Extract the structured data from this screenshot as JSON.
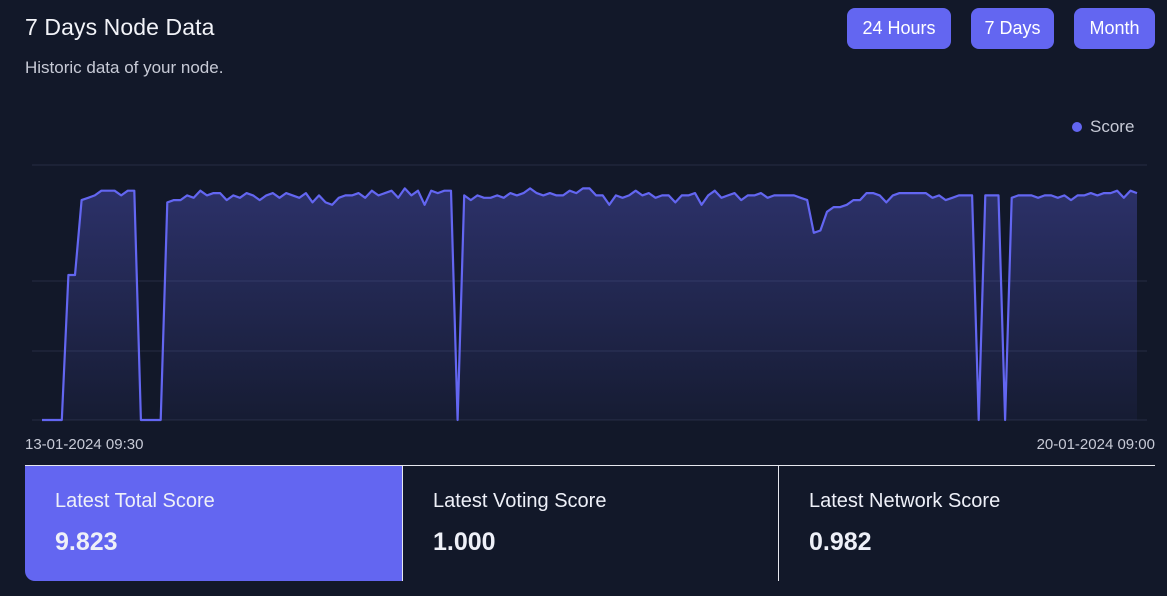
{
  "header": {
    "title": "7 Days Node Data",
    "subtitle": "Historic data of your node."
  },
  "range_buttons": [
    "24 Hours",
    "7 Days",
    "Month"
  ],
  "colors": {
    "accent": "#6366f1",
    "background": "#121829"
  },
  "chart_data": {
    "type": "area",
    "title": "",
    "xlabel": "",
    "ylabel": "",
    "legend": {
      "position": "top-right",
      "entries": [
        "Score"
      ]
    },
    "grid": true,
    "x_start_label": "13-01-2024 09:30",
    "x_end_label": "20-01-2024 09:00",
    "ylim": [
      0,
      10.9
    ],
    "series": [
      {
        "name": "Score",
        "values": [
          0,
          0,
          0,
          0,
          6.2,
          6.2,
          9.4,
          9.5,
          9.6,
          9.8,
          9.8,
          9.8,
          9.6,
          9.8,
          9.8,
          0,
          0,
          0,
          0,
          9.3,
          9.4,
          9.4,
          9.6,
          9.5,
          9.8,
          9.6,
          9.7,
          9.7,
          9.4,
          9.6,
          9.5,
          9.7,
          9.6,
          9.4,
          9.6,
          9.7,
          9.5,
          9.7,
          9.6,
          9.5,
          9.7,
          9.3,
          9.6,
          9.3,
          9.2,
          9.5,
          9.6,
          9.6,
          9.7,
          9.5,
          9.8,
          9.6,
          9.7,
          9.8,
          9.5,
          9.9,
          9.6,
          9.8,
          9.2,
          9.8,
          9.7,
          9.8,
          9.8,
          0,
          9.6,
          9.4,
          9.6,
          9.5,
          9.5,
          9.6,
          9.5,
          9.7,
          9.6,
          9.7,
          9.9,
          9.7,
          9.6,
          9.7,
          9.6,
          9.6,
          9.8,
          9.7,
          9.9,
          9.9,
          9.6,
          9.6,
          9.2,
          9.6,
          9.5,
          9.6,
          9.8,
          9.6,
          9.7,
          9.5,
          9.6,
          9.6,
          9.3,
          9.6,
          9.6,
          9.7,
          9.2,
          9.6,
          9.8,
          9.5,
          9.6,
          9.7,
          9.4,
          9.6,
          9.6,
          9.7,
          9.5,
          9.6,
          9.6,
          9.6,
          9.6,
          9.5,
          9.4,
          8.0,
          8.1,
          8.9,
          9.1,
          9.1,
          9.2,
          9.4,
          9.4,
          9.7,
          9.7,
          9.6,
          9.3,
          9.6,
          9.7,
          9.7,
          9.7,
          9.7,
          9.7,
          9.5,
          9.6,
          9.4,
          9.5,
          9.6,
          9.6,
          9.6,
          0,
          9.6,
          9.6,
          9.6,
          0,
          9.5,
          9.6,
          9.6,
          9.6,
          9.5,
          9.6,
          9.6,
          9.5,
          9.6,
          9.4,
          9.6,
          9.6,
          9.7,
          9.6,
          9.7,
          9.7,
          9.8,
          9.5,
          9.8,
          9.7
        ]
      }
    ]
  },
  "stats": [
    {
      "label": "Latest Total Score",
      "value": "9.823"
    },
    {
      "label": "Latest Voting Score",
      "value": "1.000"
    },
    {
      "label": "Latest Network Score",
      "value": "0.982"
    }
  ]
}
